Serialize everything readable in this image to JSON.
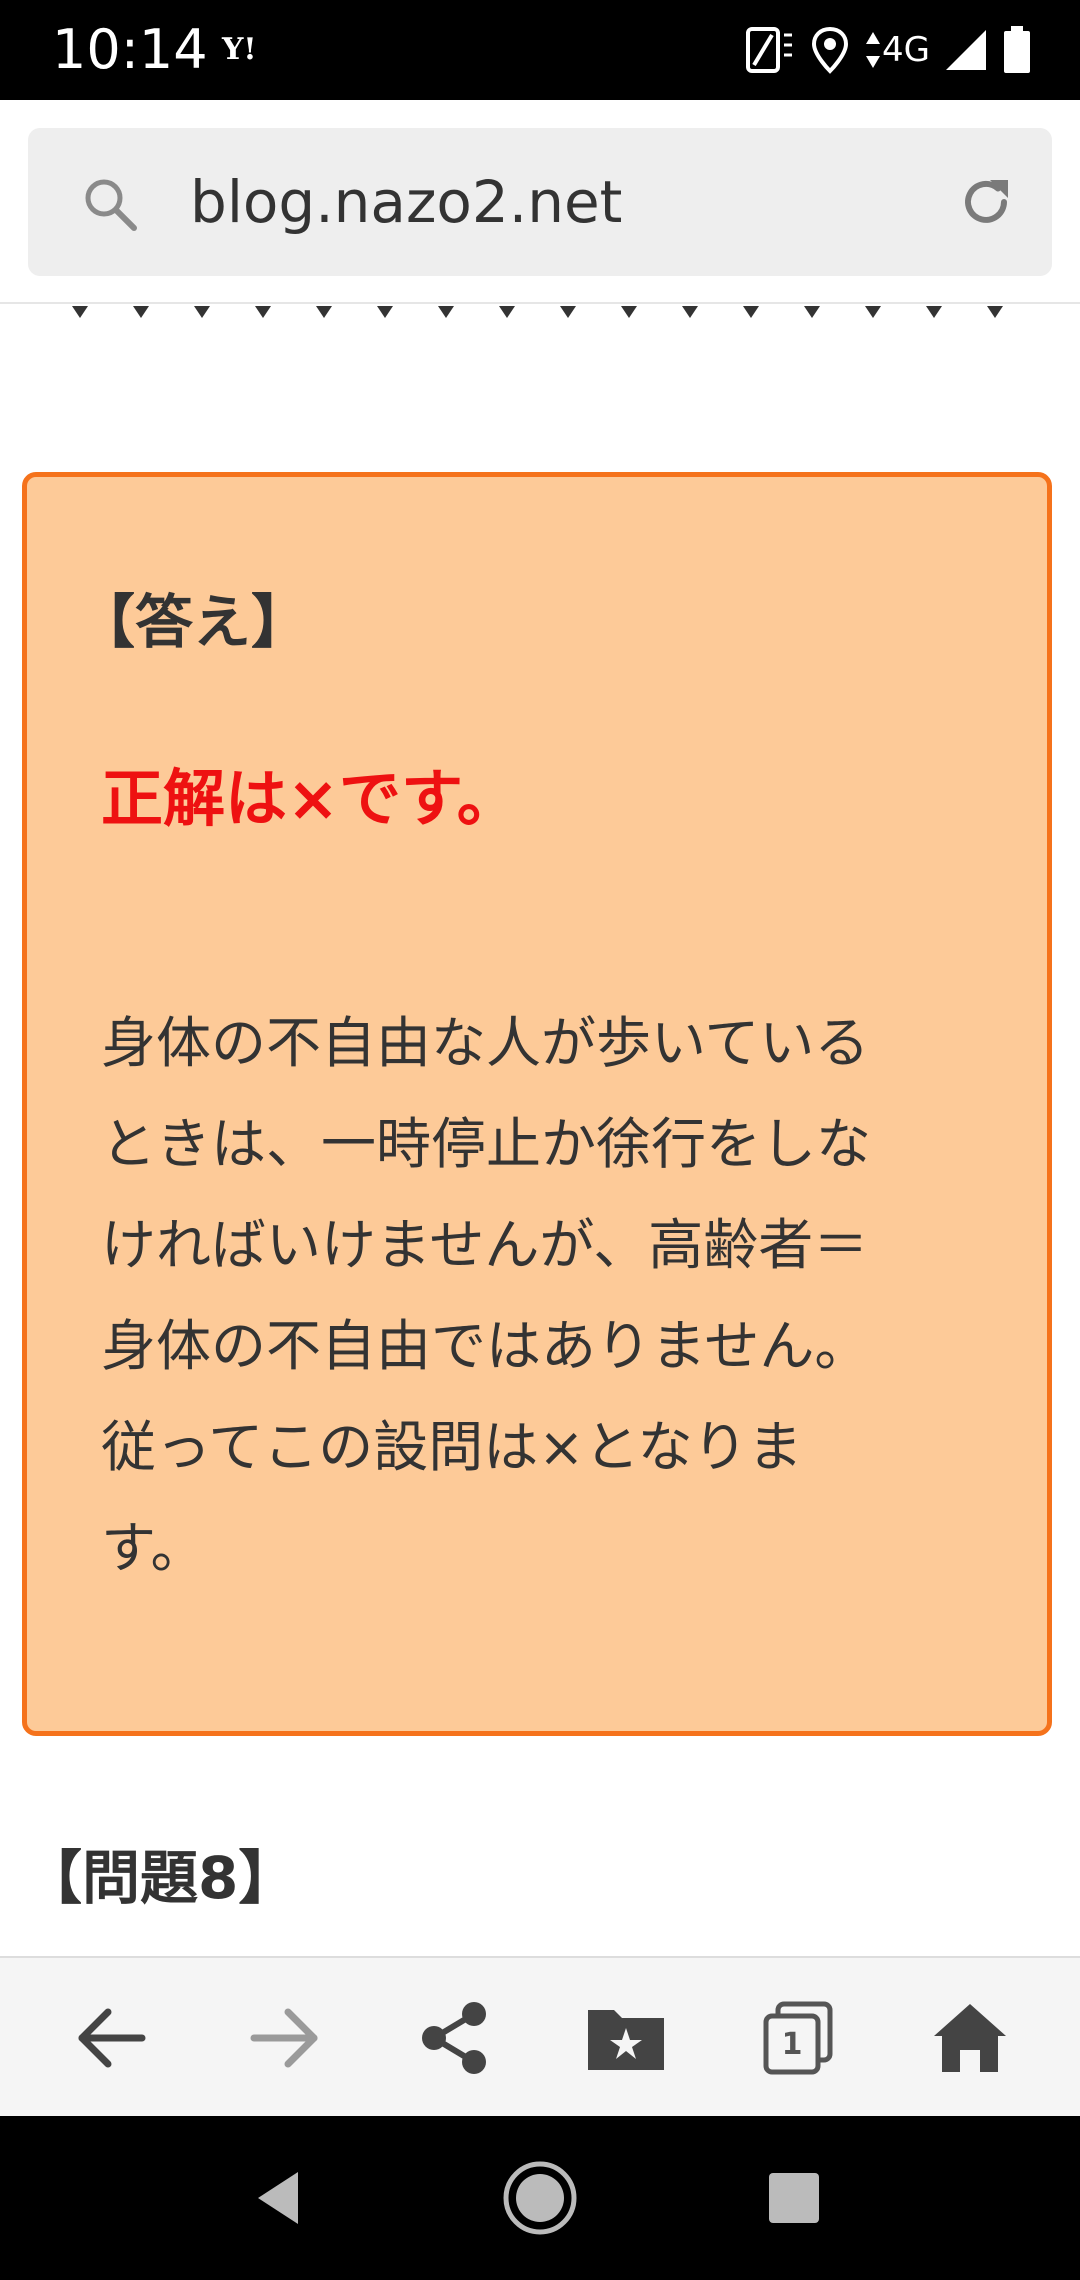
{
  "status_bar": {
    "time": "10:14",
    "app_badge": "Y!",
    "network": "4G"
  },
  "browser": {
    "url": "blog.nazo2.net"
  },
  "article": {
    "answer_heading": "【答え】",
    "answer_correct": "正解は×です。",
    "answer_explanation": "身体の不自由な人が歩いている\nときは、一時停止か徐行をしな\nければいけませんが、高齢者＝\n身体の不自由ではありません。\n従ってこの設問は×となりま\nす。",
    "next_heading": "【問題8】"
  },
  "toolbar": {
    "tabs_count": "1"
  },
  "colors": {
    "answer_bg": "#fdca98",
    "answer_border": "#f5721b",
    "answer_correct_text": "#ee1111"
  }
}
